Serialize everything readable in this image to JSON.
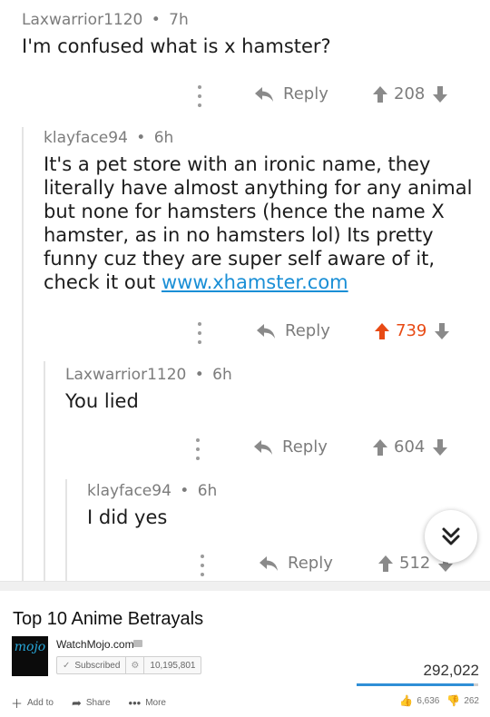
{
  "comments": [
    {
      "author": "Laxwarrior1120",
      "age": "7h",
      "body": "I'm confused what is x hamster?",
      "reply_label": "Reply",
      "score": "208",
      "upvoted": false
    },
    {
      "author": "klayface94",
      "age": "6h",
      "body_lines": [
        "It's a pet store with an ironic name, they",
        "literally have almost anything for any animal",
        "but none for hamsters (hence the name X",
        "hamster, as in no hamsters lol) Its pretty",
        "funny cuz they are super self aware of it,",
        "check it out "
      ],
      "link": "www.xhamster.com",
      "reply_label": "Reply",
      "score": "739",
      "upvoted": true
    },
    {
      "author": "Laxwarrior1120",
      "age": "6h",
      "body": "You lied",
      "reply_label": "Reply",
      "score": "604",
      "upvoted": false
    },
    {
      "author": "klayface94",
      "age": "6h",
      "body": "I did yes",
      "reply_label": "Reply",
      "score": "512",
      "upvoted": false
    }
  ],
  "separator": "•",
  "colors": {
    "upvote_active": "#e84a14",
    "link": "#1a8fd6",
    "meta": "#7c7c7c"
  },
  "youtube": {
    "title": "Top 10 Anime Betrayals",
    "channel_logo_text": "mojo",
    "channel_name": "WatchMojo.com",
    "subscribed_label": "Subscribed",
    "subscriber_count": "10,195,801",
    "views": "292,022",
    "like_ratio": 0.96,
    "actions": [
      {
        "icon": "plus-icon",
        "label": "Add to"
      },
      {
        "icon": "share-icon",
        "label": "Share"
      },
      {
        "icon": "more-icon",
        "label": "More"
      }
    ],
    "likes": "6,636",
    "dislikes": "262"
  }
}
